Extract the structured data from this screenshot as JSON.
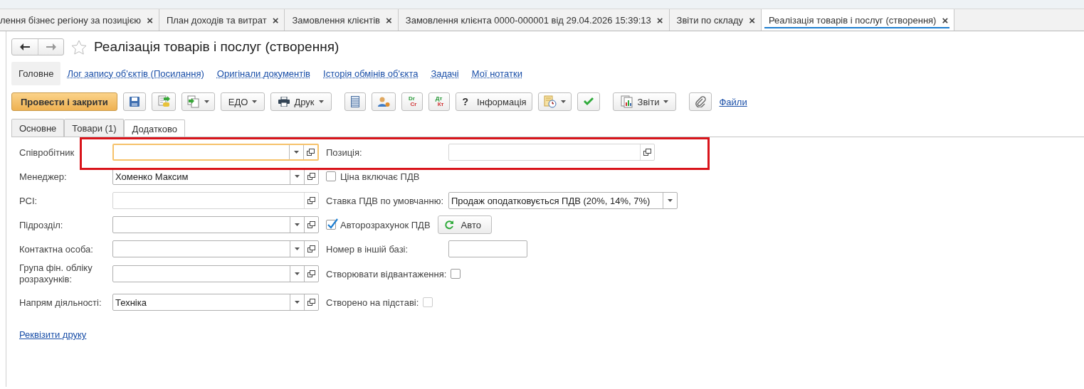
{
  "tabs": [
    {
      "label": "лення бізнес регіону за позицією",
      "selected": false
    },
    {
      "label": "План доходів та витрат",
      "selected": false
    },
    {
      "label": "Замовлення клієнтів",
      "selected": false
    },
    {
      "label": "Замовлення клієнта 0000-000001 від 29.04.2026 15:39:13",
      "selected": false
    },
    {
      "label": "Звіти по складу",
      "selected": false
    },
    {
      "label": "Реалізація товарів і послуг (створення)",
      "selected": true
    }
  ],
  "close_char": "×",
  "page_title": "Реалізація товарів і послуг (створення)",
  "nav_links": [
    {
      "label": "Головне",
      "selected": true
    },
    {
      "label": "Лог запису об'єктів (Посилання)",
      "selected": false
    },
    {
      "label": "Оригінали документів",
      "selected": false
    },
    {
      "label": "Історія обмінів об'єкта",
      "selected": false
    },
    {
      "label": "Задачі",
      "selected": false
    },
    {
      "label": "Мої нотатки",
      "selected": false
    }
  ],
  "toolbar": [
    {
      "kind": "primary",
      "label": "Провести і закрити"
    },
    {
      "kind": "icon"
    },
    {
      "kind": "icon"
    },
    {
      "kind": "icon-menu"
    },
    {
      "kind": "menu",
      "label": "ЕДО"
    },
    {
      "kind": "menu",
      "label": "Друк"
    },
    {
      "kind": "icon"
    },
    {
      "kind": "icon"
    },
    {
      "kind": "account",
      "top": "Dr",
      "bottom": "Cr"
    },
    {
      "kind": "account",
      "top": "Дт",
      "bottom": "Кт"
    },
    {
      "kind": "button",
      "label": "Інформація",
      "glyph": "?"
    },
    {
      "kind": "icon-menu"
    },
    {
      "kind": "icon"
    },
    {
      "kind": "menu",
      "label": "Звіти"
    },
    {
      "kind": "icon"
    },
    {
      "kind": "link",
      "label": "Файли"
    }
  ],
  "form_tabs": [
    {
      "label": "Основне",
      "selected": false
    },
    {
      "label": "Товари (1)",
      "selected": false
    },
    {
      "label": "Додатково",
      "selected": true
    }
  ],
  "left_fields": [
    {
      "label": "Співробітник",
      "kind": "select",
      "focused": true
    },
    {
      "label": "Менеджер:",
      "kind": "select",
      "value": "Хоменко Максим",
      "focused": false
    },
    {
      "label": "РСІ:",
      "kind": "ref",
      "focused": false
    },
    {
      "label": "Підрозділ:",
      "kind": "select",
      "focused": false
    },
    {
      "label": "Контактна особа:",
      "kind": "select",
      "focused": false
    },
    {
      "label": "Група фін. обліку розрахунків:",
      "kind": "select",
      "focused": false
    },
    {
      "label": "Напрям діяльності:",
      "kind": "select",
      "value": "Техніка",
      "focused": false
    }
  ],
  "right_fields": [
    {
      "label": "Позиція:",
      "kind": "ref"
    },
    {
      "label": "Ціна включає ПДВ",
      "kind": "checkbox",
      "checked": false
    },
    {
      "label": "Ставка ПДВ по умовчанню:",
      "kind": "combo",
      "value": "Продаж оподатковується ПДВ (20%, 14%, 7%)"
    },
    {
      "label": "Авторозрахунок ПДВ",
      "kind": "checkbox",
      "checked": true,
      "button": "Авто"
    },
    {
      "label": "Номер в іншій базі:",
      "kind": "text"
    },
    {
      "label": "Створювати відвантаження:",
      "kind": "flag",
      "checked": false,
      "disabled": false
    },
    {
      "label": "Створено на підставі:",
      "kind": "flag",
      "checked": false,
      "disabled": true
    }
  ],
  "print_link": "Реквізити друку"
}
